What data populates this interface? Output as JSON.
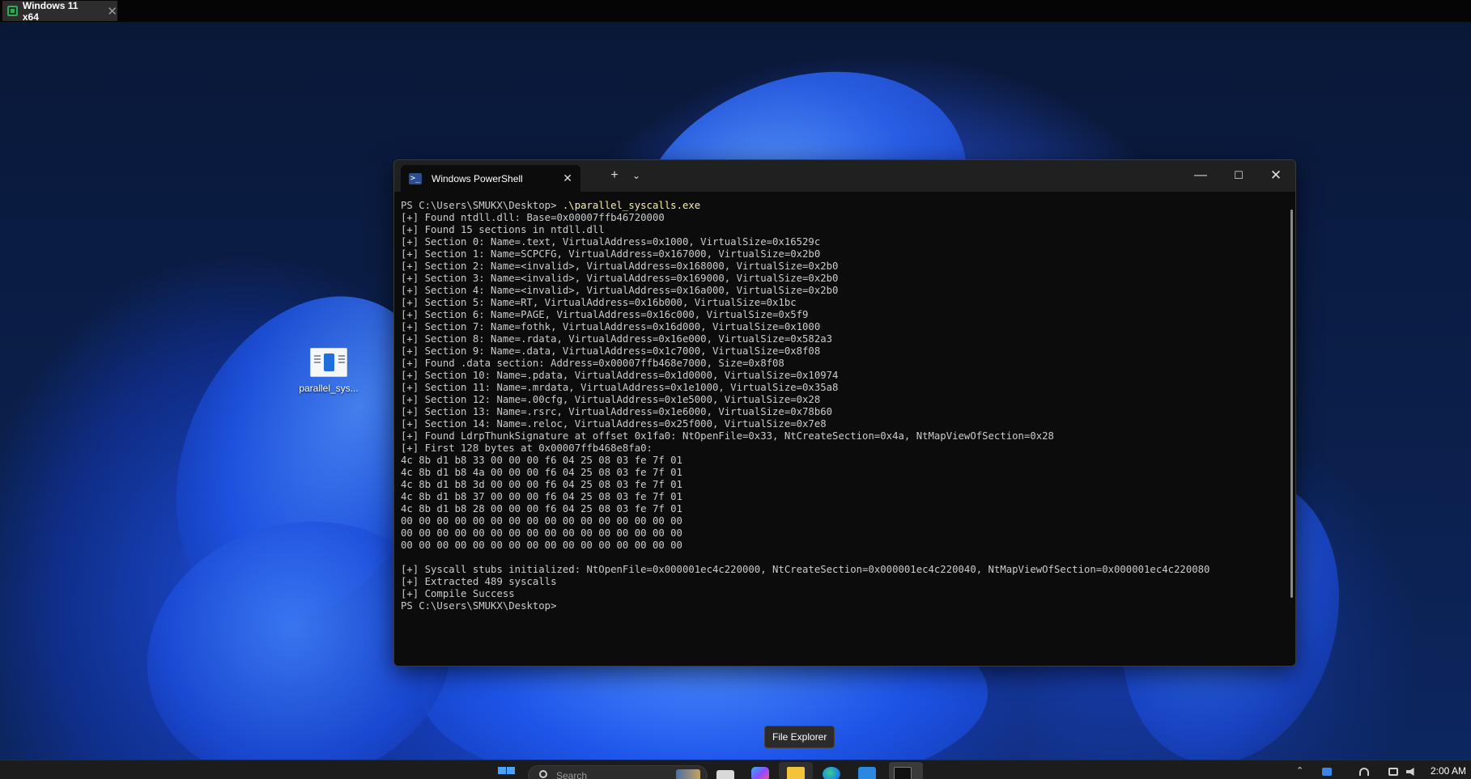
{
  "vm": {
    "tab_title": "Windows 11 x64",
    "close_glyph": "✕"
  },
  "desktop": {
    "icons": [
      {
        "label": "parallel_sys...",
        "icon": "executable-file-icon"
      }
    ]
  },
  "terminal": {
    "tab_title": "Windows PowerShell",
    "tab_icon": "powershell-icon",
    "prompt": "PS C:\\Users\\SMUKX\\Desktop>",
    "command": " .\\parallel_syscalls.exe",
    "output_lines": [
      "[+] Found ntdll.dll: Base=0x00007ffb46720000",
      "[+] Found 15 sections in ntdll.dll",
      "[+] Section 0: Name=.text, VirtualAddress=0x1000, VirtualSize=0x16529c",
      "[+] Section 1: Name=SCPCFG, VirtualAddress=0x167000, VirtualSize=0x2b0",
      "[+] Section 2: Name=<invalid>, VirtualAddress=0x168000, VirtualSize=0x2b0",
      "[+] Section 3: Name=<invalid>, VirtualAddress=0x169000, VirtualSize=0x2b0",
      "[+] Section 4: Name=<invalid>, VirtualAddress=0x16a000, VirtualSize=0x2b0",
      "[+] Section 5: Name=RT, VirtualAddress=0x16b000, VirtualSize=0x1bc",
      "[+] Section 6: Name=PAGE, VirtualAddress=0x16c000, VirtualSize=0x5f9",
      "[+] Section 7: Name=fothk, VirtualAddress=0x16d000, VirtualSize=0x1000",
      "[+] Section 8: Name=.rdata, VirtualAddress=0x16e000, VirtualSize=0x582a3",
      "[+] Section 9: Name=.data, VirtualAddress=0x1c7000, VirtualSize=0x8f08",
      "[+] Found .data section: Address=0x00007ffb468e7000, Size=0x8f08",
      "[+] Section 10: Name=.pdata, VirtualAddress=0x1d0000, VirtualSize=0x10974",
      "[+] Section 11: Name=.mrdata, VirtualAddress=0x1e1000, VirtualSize=0x35a8",
      "[+] Section 12: Name=.00cfg, VirtualAddress=0x1e5000, VirtualSize=0x28",
      "[+] Section 13: Name=.rsrc, VirtualAddress=0x1e6000, VirtualSize=0x78b60",
      "[+] Section 14: Name=.reloc, VirtualAddress=0x25f000, VirtualSize=0x7e8",
      "[+] Found LdrpThunkSignature at offset 0x1fa0: NtOpenFile=0x33, NtCreateSection=0x4a, NtMapViewOfSection=0x28",
      "[+] First 128 bytes at 0x00007ffb468e8fa0:",
      "4c 8b d1 b8 33 00 00 00 f6 04 25 08 03 fe 7f 01",
      "4c 8b d1 b8 4a 00 00 00 f6 04 25 08 03 fe 7f 01",
      "4c 8b d1 b8 3d 00 00 00 f6 04 25 08 03 fe 7f 01",
      "4c 8b d1 b8 37 00 00 00 f6 04 25 08 03 fe 7f 01",
      "4c 8b d1 b8 28 00 00 00 f6 04 25 08 03 fe 7f 01",
      "00 00 00 00 00 00 00 00 00 00 00 00 00 00 00 00",
      "00 00 00 00 00 00 00 00 00 00 00 00 00 00 00 00",
      "00 00 00 00 00 00 00 00 00 00 00 00 00 00 00 00",
      "",
      "[+] Syscall stubs initialized: NtOpenFile=0x000001ec4c220000, NtCreateSection=0x000001ec4c220040, NtMapViewOfSection=0x000001ec4c220080",
      "[+] Extracted 489 syscalls",
      "[+] Compile Success",
      "PS C:\\Users\\SMUKX\\Desktop>"
    ]
  },
  "tooltip": {
    "text": "File Explorer"
  },
  "taskbar": {
    "search_placeholder": "Search",
    "pinned": [
      "task-view",
      "copilot",
      "file-explorer",
      "edge",
      "microsoft-store",
      "terminal"
    ],
    "clock": "2:00 AM",
    "accent_color": "#4aa3ff"
  }
}
